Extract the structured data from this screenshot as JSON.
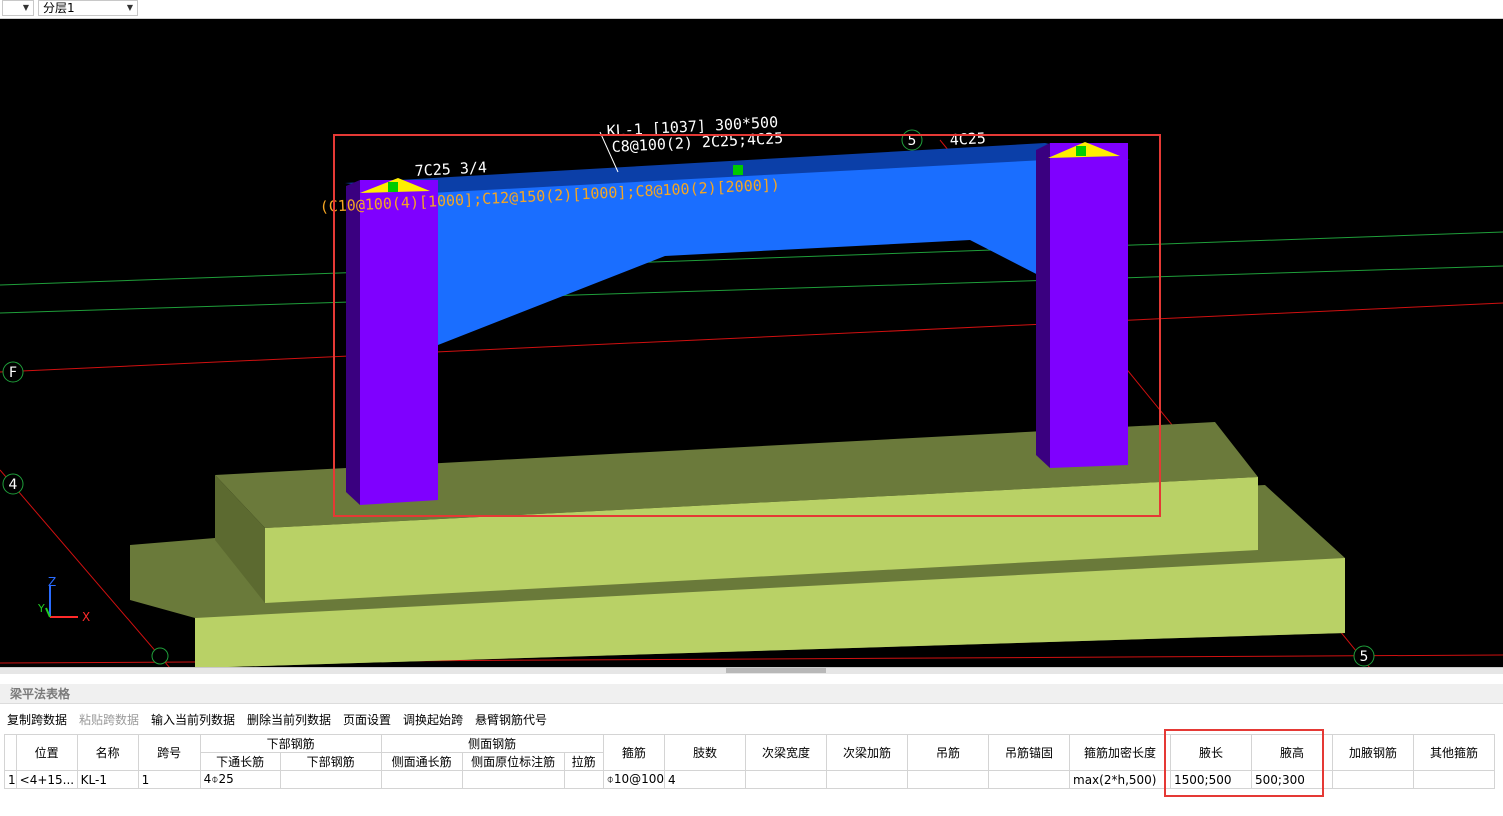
{
  "top_bar": {
    "combo1": "",
    "combo2": "分层1"
  },
  "viewport": {
    "axis_labels": {
      "grid_f": "F",
      "grid_4": "4",
      "grid_5_top": "5",
      "grid_5_bottom": "5",
      "x": "X",
      "y": "Y",
      "z": "Z"
    },
    "annotations": {
      "beam_name": "KL-1 [1037] 300*500",
      "stirrup": "C8@100(2) 2C25;4C25",
      "left_top_rebar": "7C25 3/4",
      "right_top_rebar": "4C25",
      "haunch_rebar": "(C10@100(4)[1000];C12@150(2)[1000];C8@100(2)[2000])"
    },
    "colors": {
      "background": "#000000",
      "beam": "#1a6eff",
      "column": "#7f00ff",
      "foundation": "#b9d166",
      "grid_line": "#d01010",
      "selection": "#e53935"
    }
  },
  "panel": {
    "title": "梁平法表格"
  },
  "toolbar": {
    "copy_span": "复制跨数据",
    "paste_span": "粘贴跨数据",
    "input_col": "输入当前列数据",
    "delete_col": "删除当前列数据",
    "page_setup": "页面设置",
    "adjust_start": "调换起始跨",
    "cantilever_code": "悬臂钢筋代号"
  },
  "table": {
    "headers": {
      "position": "位置",
      "name": "名称",
      "span_no": "跨号",
      "bottom_rebar": "下部钢筋",
      "bottom_through": "下通长筋",
      "bottom_rebar_sub": "下部钢筋",
      "side_rebar": "侧面钢筋",
      "side_through": "侧面通长筋",
      "side_orig": "侧面原位标注筋",
      "tie_bar": "拉筋",
      "stirrup": "箍筋",
      "legs": "肢数",
      "sec_beam_width": "次梁宽度",
      "sec_beam_add": "次梁加筋",
      "hanger": "吊筋",
      "hanger_anchor": "吊筋锚固",
      "stirrup_dense_len": "箍筋加密长度",
      "haunch_len": "腋长",
      "haunch_height": "腋高",
      "haunch_rebar": "加腋钢筋",
      "other_stirrup": "其他箍筋"
    },
    "row": {
      "num": "1",
      "position": "<4+15...",
      "name": "KL-1",
      "span_no": "1",
      "bottom_through": "4⌽25",
      "bottom_rebar": "",
      "side_through": "",
      "side_orig": "",
      "tie_bar": "",
      "stirrup": "⌽10@100",
      "legs": "4",
      "sec_beam_width": "",
      "sec_beam_add": "",
      "hanger": "",
      "hanger_anchor": "",
      "stirrup_dense_len": "max(2*h,500)",
      "haunch_len": "1500;500",
      "haunch_height": "500;300",
      "haunch_rebar": "",
      "other_stirrup": ""
    }
  }
}
